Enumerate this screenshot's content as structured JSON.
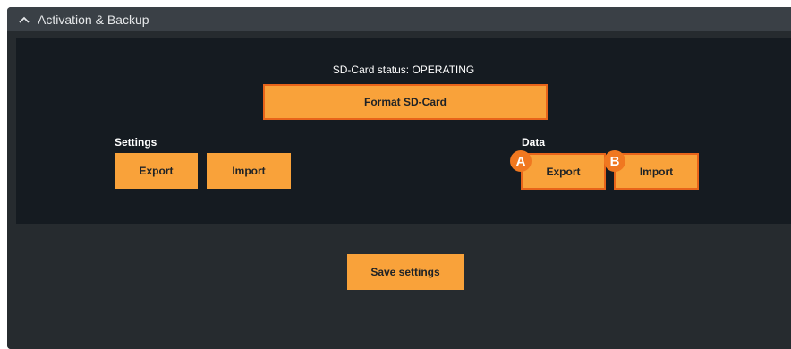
{
  "header": {
    "title": "Activation & Backup",
    "toggle_icon": "chevron-up-icon"
  },
  "sd_card": {
    "status_text": "SD-Card status: OPERATING",
    "format_label": "Format SD-Card"
  },
  "settings": {
    "heading": "Settings",
    "export_label": "Export",
    "import_label": "Import"
  },
  "data": {
    "heading": "Data",
    "export_label": "Export",
    "import_label": "Import",
    "marker_a": "A",
    "marker_b": "B"
  },
  "footer": {
    "save_label": "Save settings"
  },
  "colors": {
    "accent": "#f9a23a",
    "highlight_border": "#e8641a",
    "marker": "#f07820",
    "panel": "#151b21",
    "header": "#3a4046"
  }
}
